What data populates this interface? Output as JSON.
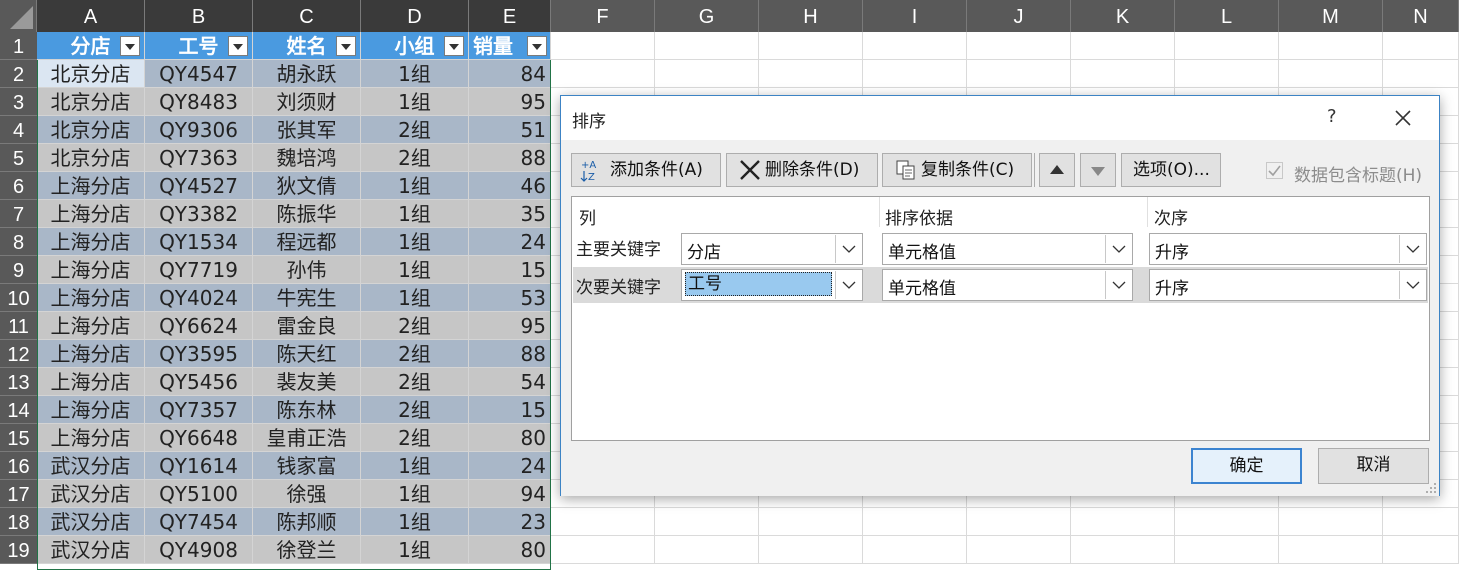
{
  "columns": [
    "A",
    "B",
    "C",
    "D",
    "E",
    "F",
    "G",
    "H",
    "I",
    "J",
    "K",
    "L",
    "M",
    "N"
  ],
  "rows": [
    "1",
    "2",
    "3",
    "4",
    "5",
    "6",
    "7",
    "8",
    "9",
    "10",
    "11",
    "12",
    "13",
    "14",
    "15",
    "16",
    "17",
    "18",
    "19"
  ],
  "table": {
    "headers": [
      "分店",
      "工号",
      "姓名",
      "小组",
      "销量"
    ],
    "data": [
      [
        "北京分店",
        "QY4547",
        "胡永跃",
        "1组",
        "84"
      ],
      [
        "北京分店",
        "QY8483",
        "刘须财",
        "1组",
        "95"
      ],
      [
        "北京分店",
        "QY9306",
        "张其军",
        "2组",
        "51"
      ],
      [
        "北京分店",
        "QY7363",
        "魏培鸿",
        "2组",
        "88"
      ],
      [
        "上海分店",
        "QY4527",
        "狄文倩",
        "1组",
        "46"
      ],
      [
        "上海分店",
        "QY3382",
        "陈振华",
        "1组",
        "35"
      ],
      [
        "上海分店",
        "QY1534",
        "程远都",
        "1组",
        "24"
      ],
      [
        "上海分店",
        "QY7719",
        "孙伟",
        "1组",
        "15"
      ],
      [
        "上海分店",
        "QY4024",
        "牛宪生",
        "1组",
        "53"
      ],
      [
        "上海分店",
        "QY6624",
        "雷金良",
        "2组",
        "95"
      ],
      [
        "上海分店",
        "QY3595",
        "陈天红",
        "2组",
        "88"
      ],
      [
        "上海分店",
        "QY5456",
        "裴友美",
        "2组",
        "54"
      ],
      [
        "上海分店",
        "QY7357",
        "陈东林",
        "2组",
        "15"
      ],
      [
        "上海分店",
        "QY6648",
        "皇甫正浩",
        "2组",
        "80"
      ],
      [
        "武汉分店",
        "QY1614",
        "钱家富",
        "1组",
        "24"
      ],
      [
        "武汉分店",
        "QY5100",
        "徐强",
        "1组",
        "94"
      ],
      [
        "武汉分店",
        "QY7454",
        "陈邦顺",
        "1组",
        "23"
      ],
      [
        "武汉分店",
        "QY4908",
        "徐登兰",
        "1组",
        "80"
      ]
    ]
  },
  "dialog": {
    "title": "排序",
    "help": "?",
    "add_condition": "添加条件(A)",
    "delete_condition": "删除条件(D)",
    "copy_condition": "复制条件(C)",
    "options": "选项(O)...",
    "has_headers_label": "数据包含标题(H)",
    "has_headers_checked": true,
    "col_header_column": "列",
    "col_header_sorton": "排序依据",
    "col_header_order": "次序",
    "levels": [
      {
        "label": "主要关键字",
        "column": "分店",
        "sort_on": "单元格值",
        "order": "升序"
      },
      {
        "label": "次要关键字",
        "column": "工号",
        "sort_on": "单元格值",
        "order": "升序"
      }
    ],
    "ok": "确定",
    "cancel": "取消"
  },
  "colors": {
    "header_blue": "#4a9ae0",
    "band1": "#a9b7c8",
    "band2": "#c6c6c6",
    "accent": "#3c84d0"
  }
}
